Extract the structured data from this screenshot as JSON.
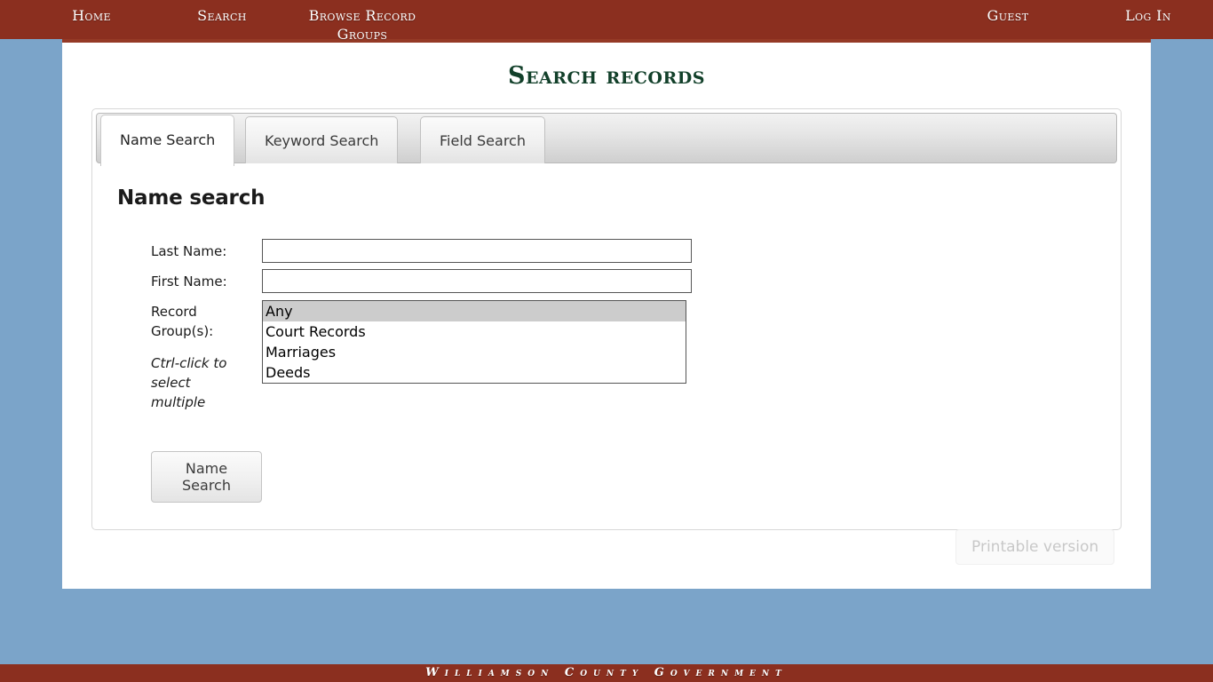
{
  "header": {
    "nav_left": [
      {
        "label": "Home",
        "name": "nav-home"
      },
      {
        "label": "Search",
        "name": "nav-search"
      },
      {
        "label": "Browse Record Groups",
        "name": "nav-browse"
      }
    ],
    "nav_right": [
      {
        "label": "Guest",
        "name": "nav-guest"
      },
      {
        "label": "Log In",
        "name": "nav-login"
      }
    ],
    "bar_color": "#8b2f1f",
    "bar_color_secondary": "#953a26"
  },
  "page": {
    "title": "Search records",
    "title_color": "#12402a",
    "background_color": "#7ba4c9",
    "panel_color": "#ffffff"
  },
  "tabs": [
    {
      "label": "Name Search",
      "active": true
    },
    {
      "label": "Keyword Search",
      "active": false
    },
    {
      "label": "Field Search",
      "active": false
    }
  ],
  "form": {
    "heading": "Name search",
    "last_name": {
      "label": "Last Name:",
      "value": "",
      "placeholder": ""
    },
    "first_name": {
      "label": "First Name:",
      "value": "",
      "placeholder": ""
    },
    "record_groups": {
      "label": "Record Group(s):",
      "hint": "Ctrl-click to select multiple",
      "options": [
        {
          "label": "Any",
          "selected": true
        },
        {
          "label": "Court Records",
          "selected": false
        },
        {
          "label": "Marriages",
          "selected": false
        },
        {
          "label": "Deeds",
          "selected": false
        }
      ]
    },
    "submit_label": "Name Search"
  },
  "printable": {
    "label": "Printable version"
  },
  "footer": {
    "text": "Williamson County Government",
    "bar_color": "#8b2f1f"
  }
}
